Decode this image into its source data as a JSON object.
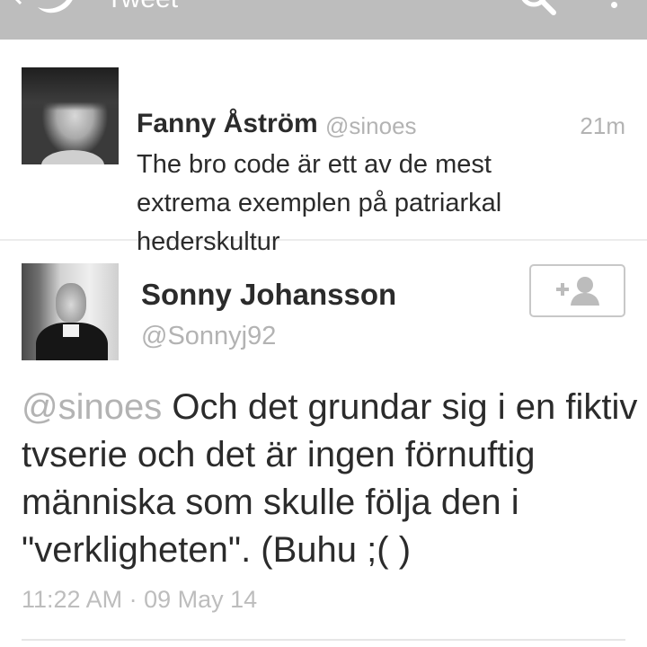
{
  "topbar": {
    "title": "Tweet",
    "icons": {
      "back": "chevron-left-icon",
      "logo": "twitter-bird-icon",
      "search": "search-icon",
      "menu": "overflow-menu-icon"
    },
    "colors": {
      "background": "#bdbdbd",
      "foreground": "#ffffff"
    }
  },
  "parent_tweet": {
    "author_name": "Fanny Åström",
    "handle": "@sinoes",
    "time": "21m",
    "text": "The bro code är ett av de mest extrema exemplen på patriarkal hederskultur"
  },
  "main_tweet": {
    "author_name": "Sonny Johansson",
    "handle": "@Sonnyj92",
    "follow_icon": "add-user-icon",
    "mention": "@sinoes",
    "text": " Och det grundar sig i en fiktiv tvserie och det är ingen förnuftig människa som skulle följa den i \"verkligheten\". (Buhu ;( )",
    "time": "11:22 AM",
    "separator": "·",
    "date": "09 May 14"
  },
  "colors": {
    "text": "#2b2b2b",
    "muted": "#b3b3b3",
    "divider": "#ececec"
  }
}
